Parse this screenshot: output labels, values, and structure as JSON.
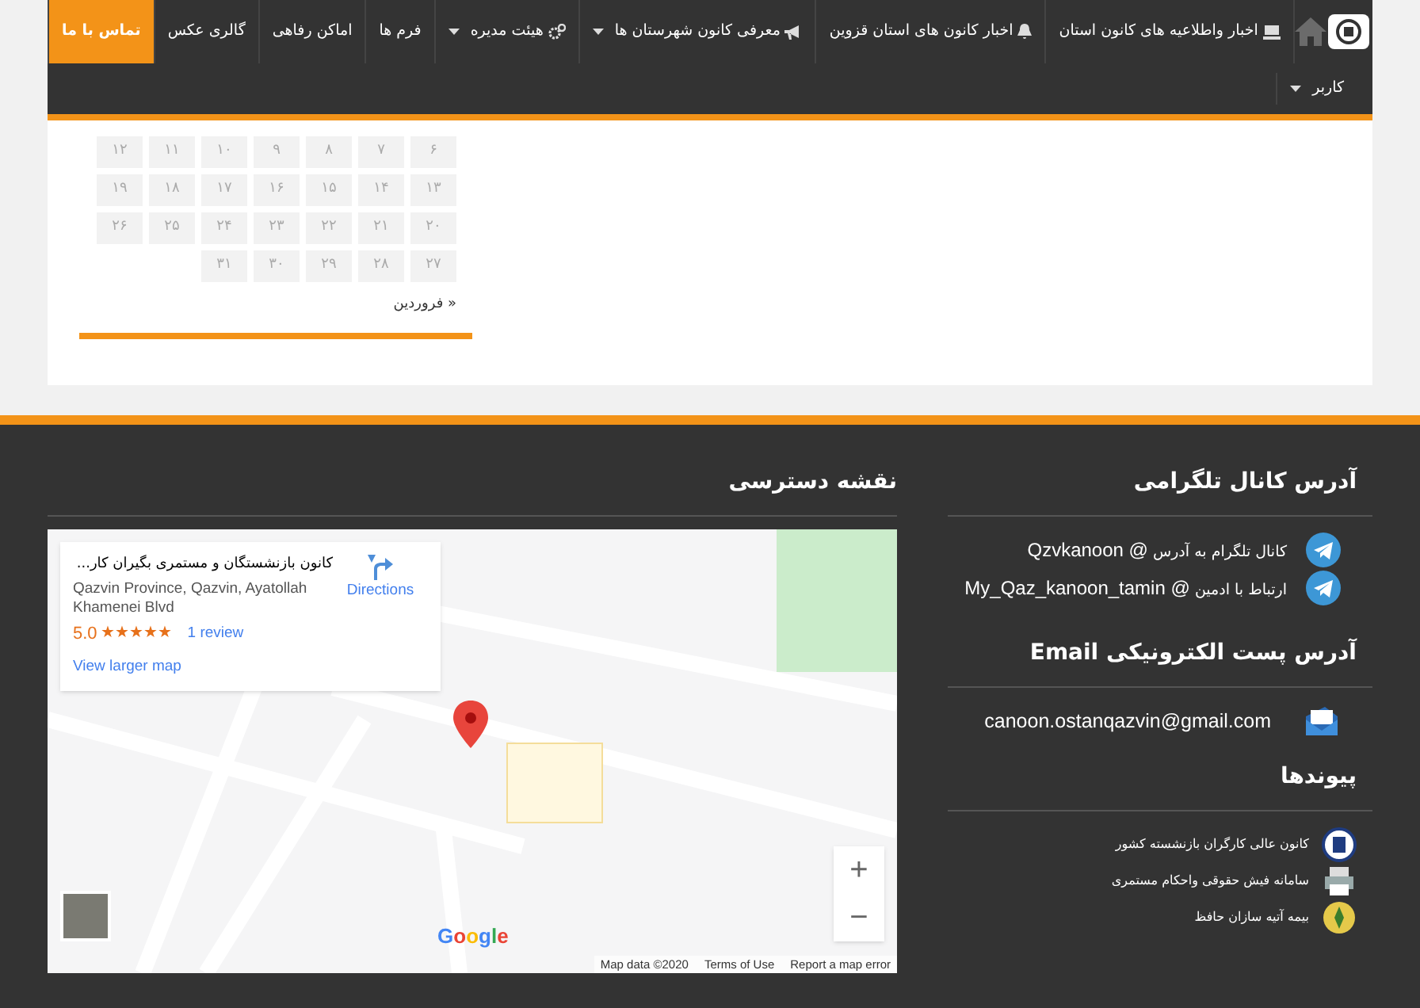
{
  "navbar": {
    "items": [
      {
        "label": "اخبار واطلاعیه های کانون استان",
        "dropdown": false,
        "selected": false
      },
      {
        "label": "اخبار کانون های استان قزوین",
        "dropdown": false,
        "selected": false
      },
      {
        "label": "معرفی کانون شهرستان ها",
        "dropdown": true,
        "selected": false
      },
      {
        "label": "هیئت مدیره",
        "dropdown": true,
        "selected": false
      },
      {
        "label": "فرم ها",
        "dropdown": false,
        "selected": false
      },
      {
        "label": "اماکن رفاهی",
        "dropdown": false,
        "selected": false
      },
      {
        "label": "گالری عکس",
        "dropdown": false,
        "selected": false
      },
      {
        "label": "تماس با ما",
        "dropdown": false,
        "selected": true
      },
      {
        "label": "کاربر",
        "dropdown": true,
        "selected": false
      }
    ]
  },
  "calendar": {
    "weeks": [
      [
        "۶",
        "۷",
        "۸",
        "۹",
        "۱۰",
        "۱۱",
        "۱۲"
      ],
      [
        "۱۳",
        "۱۴",
        "۱۵",
        "۱۶",
        "۱۷",
        "۱۸",
        "۱۹"
      ],
      [
        "۲۰",
        "۲۱",
        "۲۲",
        "۲۳",
        "۲۴",
        "۲۵",
        "۲۶"
      ],
      [
        "۲۷",
        "۲۸",
        "۲۹",
        "۳۰",
        "۳۱"
      ]
    ],
    "prev_link": "« فروردین"
  },
  "footer": {
    "telegram": {
      "heading": "آدرس کانال تلگرامی",
      "items": [
        {
          "label": "کانال تلگرام به آدرس",
          "handle": "Qzvkanoon @"
        },
        {
          "label": "ارتباط با ادمین",
          "handle": "My_Qaz_kanoon_tamin @"
        }
      ]
    },
    "email": {
      "heading": "آدرس پست الکترونیکی **Email**",
      "address": "canoon.ostanqazvin@gmail.com"
    },
    "links": {
      "heading": "پیوندها",
      "items": [
        {
          "label": "کانون عالی کارگران بازنشسته کشور"
        },
        {
          "label": "سامانه فیش حقوقی واحکام مستمری"
        },
        {
          "label": "بیمه آتیه سازان حافظ"
        }
      ]
    },
    "map": {
      "heading": "نقشه دسترسی",
      "place_name": "کانون بازنشستگان و مستمری بگیران کار...",
      "address": "Qazvin Province, Qazvin, Ayatollah Khamenei Blvd",
      "rating": "5.0",
      "stars": 5,
      "reviews": "1 review",
      "directions": "Directions",
      "larger_map": "View larger map",
      "zoom_in": "+",
      "zoom_out": "−",
      "logo": "Google",
      "attribution": [
        "Report a map error",
        "Terms of Use",
        "Map data ©2020"
      ]
    }
  }
}
